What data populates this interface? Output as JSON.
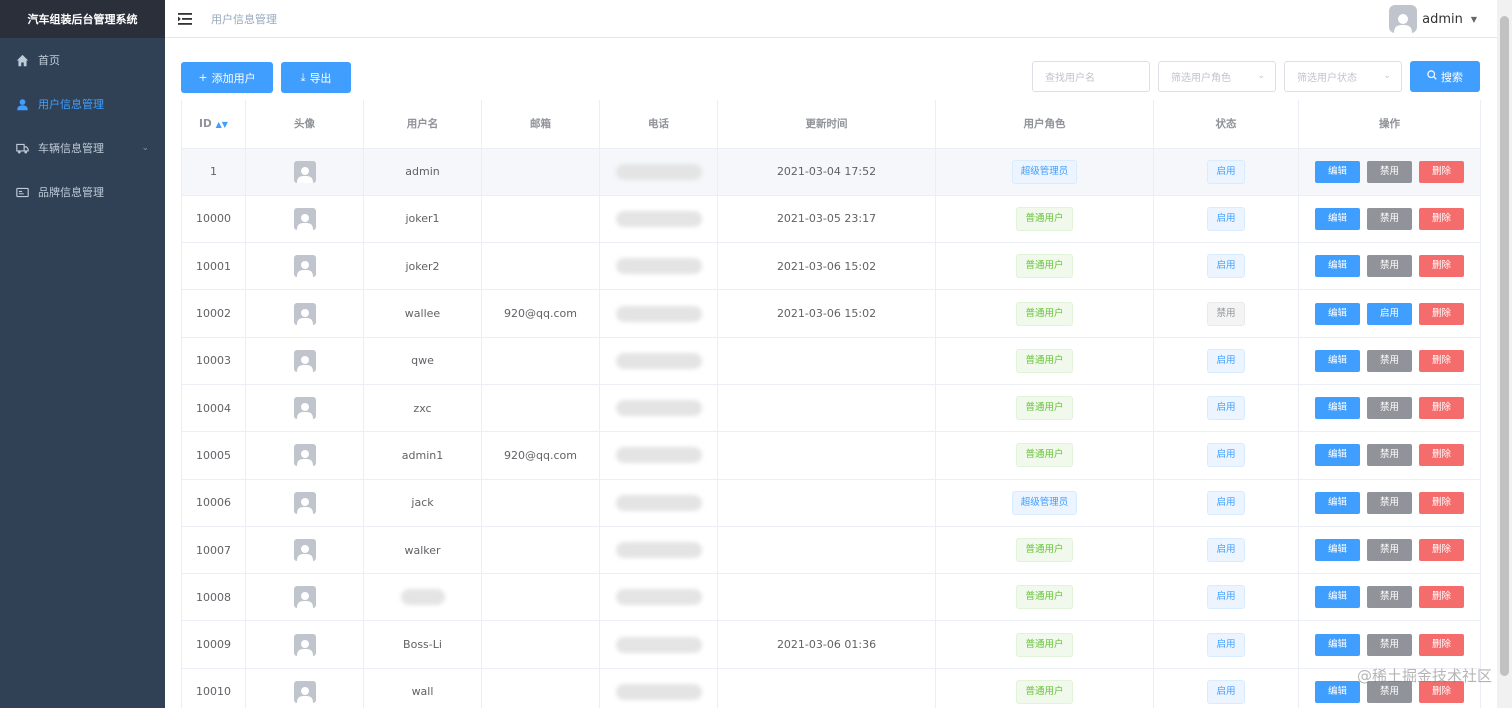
{
  "brand": "汽车组装后台管理系统",
  "sidebar": {
    "items": [
      {
        "label": "首页",
        "icon": "home-icon",
        "active": false
      },
      {
        "label": "用户信息管理",
        "icon": "user-icon",
        "active": true
      },
      {
        "label": "车辆信息管理",
        "icon": "truck-icon",
        "active": false,
        "expandable": true
      },
      {
        "label": "品牌信息管理",
        "icon": "card-icon",
        "active": false
      }
    ]
  },
  "header": {
    "breadcrumb": "用户信息管理",
    "username": "admin"
  },
  "toolbar": {
    "add_label": "添加用户",
    "export_label": "导出",
    "search_placeholder": "查找用户名",
    "role_placeholder": "筛选用户角色",
    "status_placeholder": "筛选用户状态",
    "search_label": "搜索"
  },
  "table": {
    "headers": [
      "ID",
      "头像",
      "用户名",
      "邮箱",
      "电话",
      "更新时间",
      "用户角色",
      "状态",
      "操作"
    ],
    "actions": {
      "edit": "编辑",
      "ban": "禁用",
      "enable": "启用",
      "delete": "删除"
    },
    "rows": [
      {
        "id": "1",
        "username": "admin",
        "email": "",
        "time": "2021-03-04 17:52",
        "role": "超级管理员",
        "role_type": "super",
        "status": "启用",
        "status_type": "on",
        "toggle": "禁用"
      },
      {
        "id": "10000",
        "username": "joker1",
        "email": "",
        "time": "2021-03-05 23:17",
        "role": "普通用户",
        "role_type": "normal",
        "status": "启用",
        "status_type": "on",
        "toggle": "禁用"
      },
      {
        "id": "10001",
        "username": "joker2",
        "email": "",
        "time": "2021-03-06 15:02",
        "role": "普通用户",
        "role_type": "normal",
        "status": "启用",
        "status_type": "on",
        "toggle": "禁用"
      },
      {
        "id": "10002",
        "username": "wallee",
        "email": "920@qq.com",
        "time": "2021-03-06 15:02",
        "role": "普通用户",
        "role_type": "normal",
        "status": "禁用",
        "status_type": "off",
        "toggle": "启用"
      },
      {
        "id": "10003",
        "username": "qwe",
        "email": "",
        "time": "",
        "role": "普通用户",
        "role_type": "normal",
        "status": "启用",
        "status_type": "on",
        "toggle": "禁用"
      },
      {
        "id": "10004",
        "username": "zxc",
        "email": "",
        "time": "",
        "role": "普通用户",
        "role_type": "normal",
        "status": "启用",
        "status_type": "on",
        "toggle": "禁用"
      },
      {
        "id": "10005",
        "username": "admin1",
        "email": "920@qq.com",
        "time": "",
        "role": "普通用户",
        "role_type": "normal",
        "status": "启用",
        "status_type": "on",
        "toggle": "禁用"
      },
      {
        "id": "10006",
        "username": "jack",
        "email": "",
        "time": "",
        "role": "超级管理员",
        "role_type": "super",
        "status": "启用",
        "status_type": "on",
        "toggle": "禁用"
      },
      {
        "id": "10007",
        "username": "walker",
        "email": "",
        "time": "",
        "role": "普通用户",
        "role_type": "normal",
        "status": "启用",
        "status_type": "on",
        "toggle": "禁用"
      },
      {
        "id": "10008",
        "username": "",
        "email": "",
        "time": "",
        "role": "普通用户",
        "role_type": "normal",
        "status": "启用",
        "status_type": "on",
        "toggle": "禁用"
      },
      {
        "id": "10009",
        "username": "Boss-Li",
        "email": "",
        "time": "2021-03-06 01:36",
        "role": "普通用户",
        "role_type": "normal",
        "status": "启用",
        "status_type": "on",
        "toggle": "禁用"
      },
      {
        "id": "10010",
        "username": "wall",
        "email": "",
        "time": "",
        "role": "普通用户",
        "role_type": "normal",
        "status": "启用",
        "status_type": "on",
        "toggle": "禁用"
      }
    ]
  },
  "watermark": "@稀土掘金技术社区",
  "colors": {
    "primary": "#409eff",
    "sidebar": "#304156",
    "danger": "#f56c6c",
    "info": "#909399",
    "success": "#67c23a"
  }
}
